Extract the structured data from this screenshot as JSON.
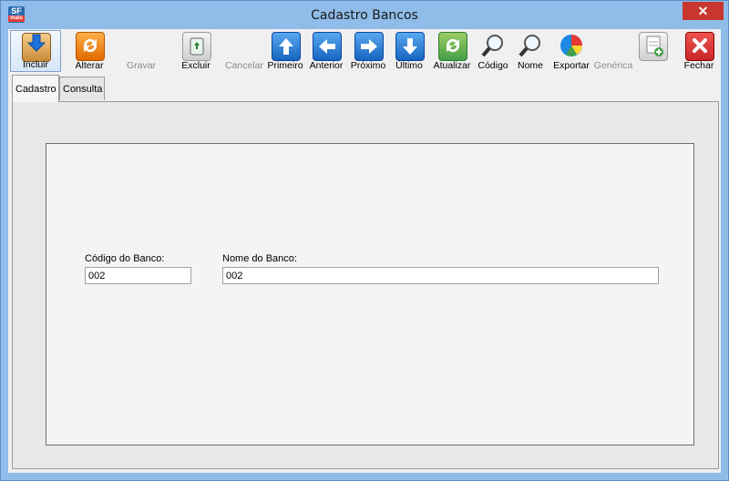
{
  "window": {
    "title": "Cadastro Bancos",
    "app_icon_text": "SF",
    "app_icon_subtext": "mais"
  },
  "toolbar": {
    "incluir": "Incluir",
    "alterar": "Alterar",
    "gravar": "Gravar",
    "excluir": "Excluir",
    "cancelar": "Cancelar",
    "primeiro": "Primeiro",
    "anterior": "Anterior",
    "proximo": "Próximo",
    "ultimo": "Último",
    "atualizar": "Atualizar",
    "codigo": "Código",
    "nome": "Nome",
    "exportar": "Exportar",
    "generica": "Genérica",
    "fechar": "Fechar"
  },
  "tabs": {
    "cadastro": "Cadastro",
    "consulta": "Consulta"
  },
  "form": {
    "codigo_label": "Código do Banco:",
    "codigo_value": "002",
    "nome_label": "Nome do Banco:",
    "nome_value": "002"
  },
  "colors": {
    "titlebar": "#8fbce8",
    "close": "#c7372f",
    "accent": "#1565c0"
  }
}
